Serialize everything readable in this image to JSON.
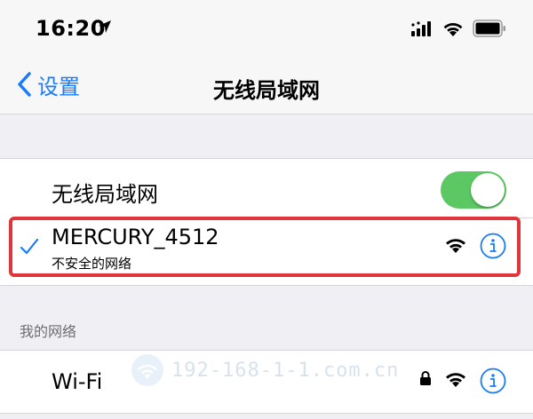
{
  "status_bar": {
    "time": "16:20",
    "icons": [
      "location-arrow-icon",
      "signal-bars-icon",
      "wifi-icon",
      "battery-icon"
    ]
  },
  "nav": {
    "back_label": "设置",
    "title": "无线局域网"
  },
  "wifi_toggle": {
    "label": "无线局域网",
    "state": "on"
  },
  "current_network": {
    "name": "MERCURY_4512",
    "subtitle": "不安全的网络",
    "connected": true
  },
  "my_networks": {
    "header": "我的网络",
    "items": [
      {
        "name": "Wi-Fi",
        "locked": true
      }
    ]
  },
  "watermark": {
    "text": "192-168-1-1.com.cn"
  },
  "colors": {
    "accent": "#1a7cf5",
    "toggle_on": "#5cc863",
    "highlight": "#e0353a",
    "background": "#efeff4"
  }
}
